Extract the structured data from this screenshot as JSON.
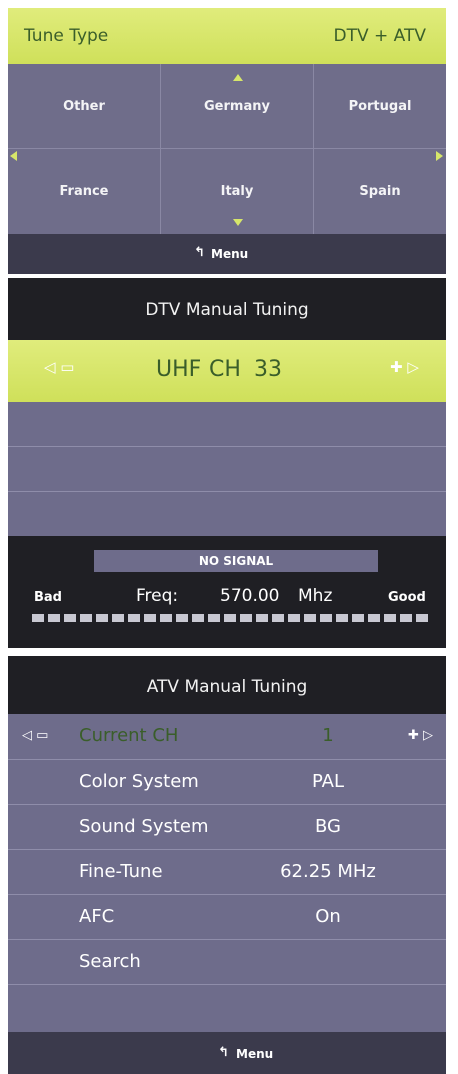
{
  "panel1": {
    "title": "Tune Type",
    "value": "DTV + ATV",
    "countries": [
      "Other",
      "Germany",
      "Portugal",
      "France",
      "Italy",
      "Spain"
    ],
    "menu_label": "Menu"
  },
  "panel2": {
    "title": "DTV Manual Tuning",
    "channel_band": "UHF",
    "channel_prefix": "CH",
    "channel_number": "33",
    "signal_status": "NO SIGNAL",
    "bad_label": "Bad",
    "good_label": "Good",
    "freq_label": "Freq:",
    "freq_value": "570.00",
    "freq_unit": "Mhz",
    "signal_level": 0
  },
  "panel3": {
    "title": "ATV Manual Tuning",
    "rows": [
      {
        "label": "Current CH",
        "value": "1"
      },
      {
        "label": "Color System",
        "value": "PAL"
      },
      {
        "label": "Sound System",
        "value": "BG"
      },
      {
        "label": "Fine-Tune",
        "value": "62.25 MHz"
      },
      {
        "label": "AFC",
        "value": "On"
      },
      {
        "label": "Search",
        "value": ""
      }
    ],
    "menu_label": "Menu"
  },
  "colors": {
    "accent": "#d6e66a",
    "menu_bg": "#6f6d8a",
    "title_bg": "#1f1f24"
  }
}
